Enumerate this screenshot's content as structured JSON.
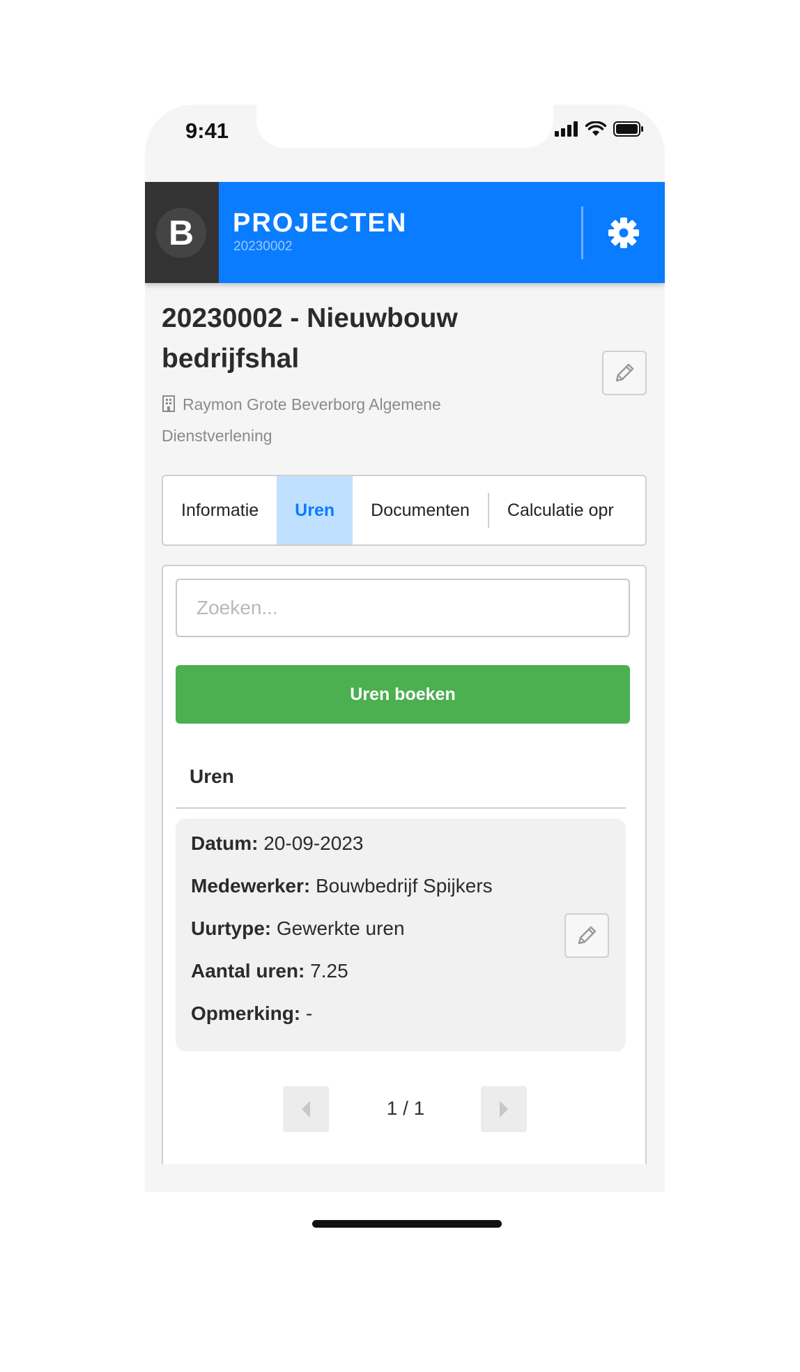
{
  "status_bar": {
    "time": "9:41"
  },
  "header": {
    "logo_letter": "B",
    "title": "PROJECTEN",
    "subtitle": "20230002",
    "brand_color": "#0a7cff",
    "settings_icon": "gear-icon"
  },
  "project": {
    "title": "20230002 - Nieuwbouw bedrijfshal",
    "client": "Raymon Grote Beverborg Algemene Dienstverlening",
    "client_icon": "building-icon",
    "edit_icon": "pencil-icon"
  },
  "tabs": [
    {
      "label": "Informatie",
      "active": false
    },
    {
      "label": "Uren",
      "active": true
    },
    {
      "label": "Documenten",
      "active": false
    },
    {
      "label": "Calculatie opr",
      "active": false
    }
  ],
  "hours": {
    "search_placeholder": "Zoeken...",
    "book_button": "Uren boeken",
    "book_button_color": "#4caf50",
    "section_title": "Uren",
    "entry": {
      "date_label": "Datum:",
      "date_value": "20-09-2023",
      "employee_label": "Medewerker:",
      "employee_value": "Bouwbedrijf Spijkers",
      "type_label": "Uurtype:",
      "type_value": "Gewerkte uren",
      "amount_label": "Aantal uren:",
      "amount_value": "7.25",
      "remark_label": "Opmerking:",
      "remark_value": "-"
    },
    "pagination": "1 / 1"
  }
}
